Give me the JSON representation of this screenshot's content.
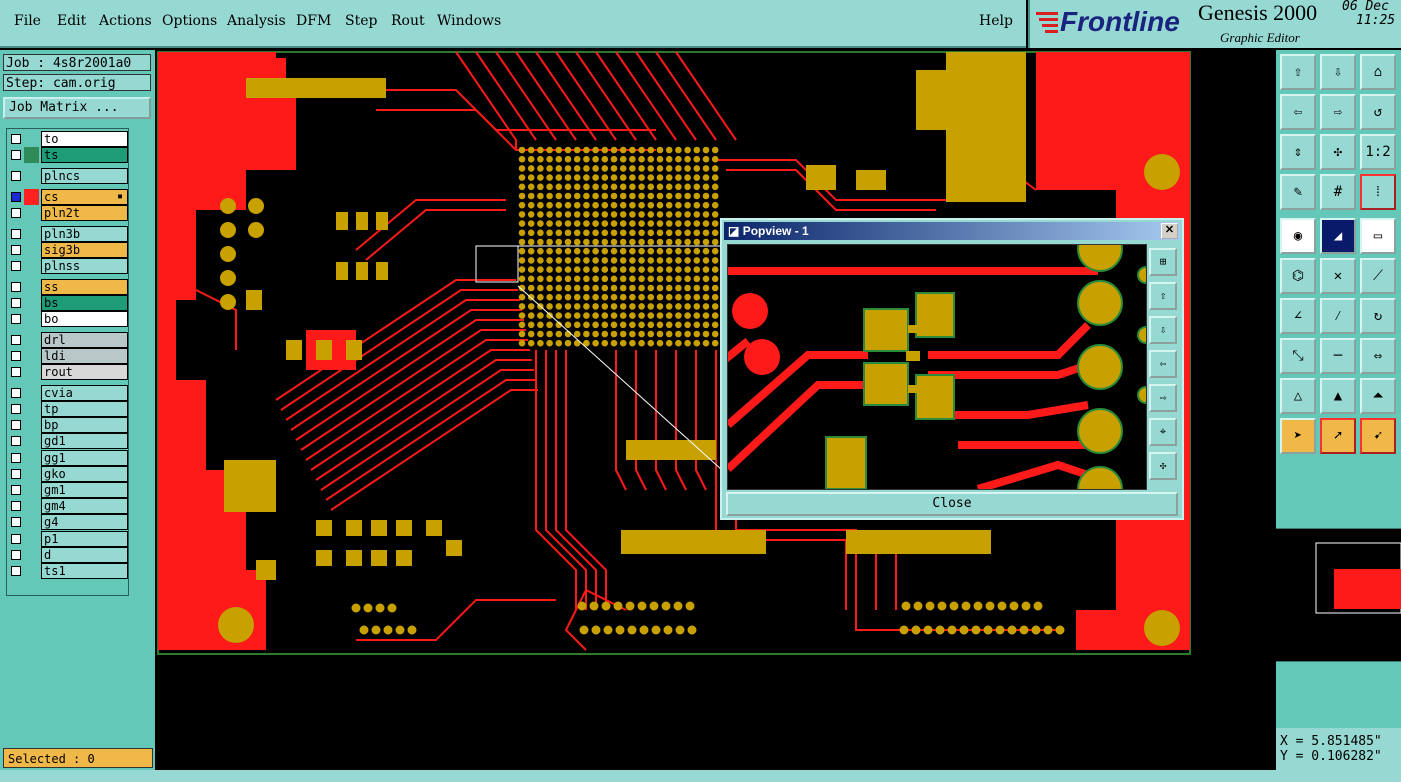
{
  "menu": {
    "items": [
      "File",
      "Edit",
      "Actions",
      "Options",
      "Analysis",
      "DFM",
      "Step",
      "Rout",
      "Windows"
    ],
    "help": "Help"
  },
  "brand": {
    "logo": "Frontline",
    "product": "Genesis 2000",
    "subtitle": "Graphic Editor",
    "date": "06 Dec",
    "time": "11:25"
  },
  "left": {
    "job": "Job : 4s8r2001a0",
    "step": "Step: cam.orig",
    "job_matrix": "Job Matrix ...",
    "selected": "Selected : 0"
  },
  "layers": [
    {
      "name": "to",
      "bg": "#ffffff",
      "color": ""
    },
    {
      "name": "ts",
      "bg": "#1e9c78",
      "color": "#2e8b57"
    },
    {
      "name": "plncs",
      "bg": "#96d8d2",
      "color": ""
    },
    {
      "name": "cs",
      "bg": "#f0b848",
      "color": "#ff2020",
      "affected": true
    },
    {
      "name": "pln2t",
      "bg": "#f0b848",
      "color": ""
    },
    {
      "name": "pln3b",
      "bg": "#96d8d2",
      "color": ""
    },
    {
      "name": "sig3b",
      "bg": "#f0b848",
      "color": ""
    },
    {
      "name": "plnss",
      "bg": "#96d8d2",
      "color": ""
    },
    {
      "name": "ss",
      "bg": "#f0b848",
      "color": ""
    },
    {
      "name": "bs",
      "bg": "#1e9c78",
      "color": ""
    },
    {
      "name": "bo",
      "bg": "#ffffff",
      "color": ""
    },
    {
      "name": "drl",
      "bg": "#b8c8c8",
      "color": ""
    },
    {
      "name": "ldi",
      "bg": "#b8c8c8",
      "color": ""
    },
    {
      "name": "rout",
      "bg": "#d8d8d8",
      "color": ""
    },
    {
      "name": "cvia",
      "bg": "#96d8d2",
      "color": ""
    },
    {
      "name": "tp",
      "bg": "#96d8d2",
      "color": ""
    },
    {
      "name": "bp",
      "bg": "#96d8d2",
      "color": ""
    },
    {
      "name": "gd1",
      "bg": "#96d8d2",
      "color": ""
    },
    {
      "name": "gg1",
      "bg": "#96d8d2",
      "color": ""
    },
    {
      "name": "gko",
      "bg": "#96d8d2",
      "color": ""
    },
    {
      "name": "gm1",
      "bg": "#96d8d2",
      "color": ""
    },
    {
      "name": "gm4",
      "bg": "#96d8d2",
      "color": ""
    },
    {
      "name": "g4",
      "bg": "#96d8d2",
      "color": ""
    },
    {
      "name": "p1",
      "bg": "#96d8d2",
      "color": ""
    },
    {
      "name": "d",
      "bg": "#96d8d2",
      "color": ""
    },
    {
      "name": "ts1",
      "bg": "#96d8d2",
      "color": ""
    }
  ],
  "popview": {
    "title": "Popview - 1",
    "close": "Close"
  },
  "coords": {
    "x": "X = 5.851485\"",
    "y": "Y = 0.106282\""
  },
  "toolbar_labels": {
    "ratio": "1:2"
  },
  "colors": {
    "copper": "#ff1a1a",
    "pad": "#c8a000",
    "panel": "#64c8b8",
    "menu": "#96d8d2"
  }
}
